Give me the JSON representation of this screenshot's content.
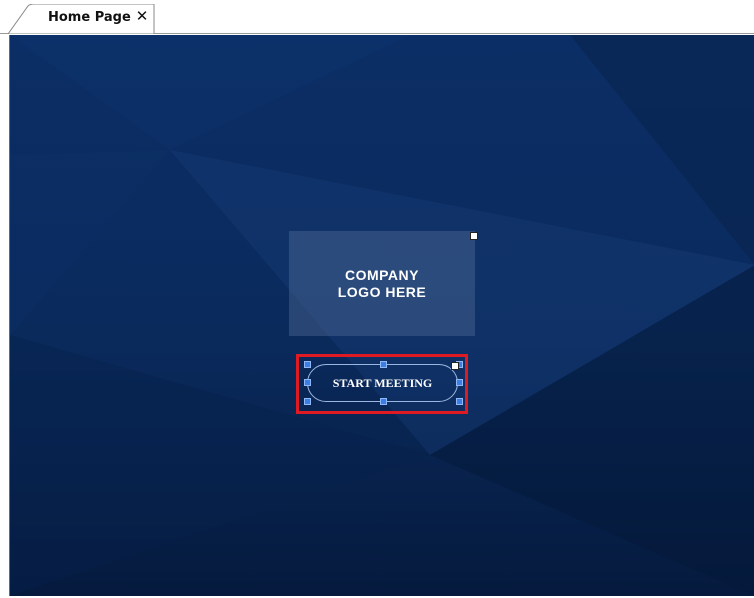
{
  "tab": {
    "label": "Home Page",
    "close_glyph": "✕"
  },
  "canvas": {
    "background_color": "#0d2a5a",
    "logo_placeholder": {
      "text": "COMPANY\nLOGO HERE"
    },
    "start_button": {
      "label": "START MEETING",
      "selected": true,
      "selection_color": "#e01a22"
    }
  },
  "icons": [
    "close-icon",
    "lock-icon",
    "selection-handle"
  ]
}
